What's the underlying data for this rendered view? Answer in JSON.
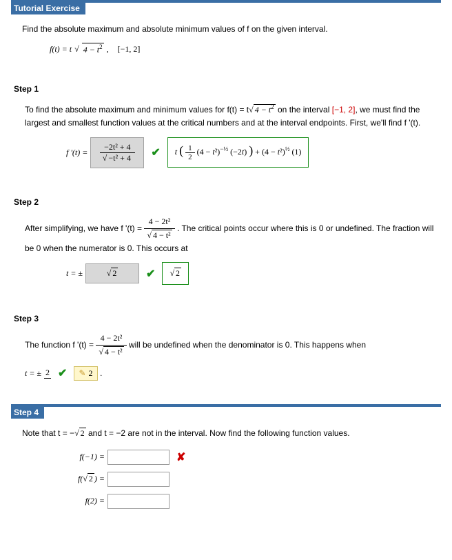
{
  "header": "Tutorial Exercise",
  "intro": {
    "prompt": "Find the absolute maximum and absolute minimum values of f on the given interval.",
    "func_lhs": "f(t) = t",
    "func_radicand": "4 − t",
    "func_exp": "2",
    "interval": "[−1, 2]"
  },
  "step1": {
    "title": "Step 1",
    "text_a": "To find the absolute maximum and minimum values for  f(t) = t",
    "text_a_rad": "4 − t",
    "text_a_exp": "2",
    "text_a2": "  on the interval  ",
    "text_interval": "[−1, 2]",
    "text_b": ",  we must find the largest and smallest function values at the critical numbers and at the interval endpoints. First, we'll find f '(t).",
    "lhs": "f '(t) =",
    "grey_num": "−2t² + 4",
    "grey_den_rad": "−t² + 4",
    "green_expr": "t ( ½ (4 − t²)^{−½} (−2t) ) + (4 − t²)^{½} (1)"
  },
  "step2": {
    "title": "Step 2",
    "text_a": "After simplifying, we have  f '(t) = ",
    "frac_num": "4 − 2t²",
    "frac_den_rad": "4 − t²",
    "text_b": ". The critical points occur where this is 0 or undefined. The fraction will be 0 when the numerator is 0. This occurs at",
    "t_equals": "t = ±",
    "grey_val_rad": "2",
    "green_val_rad": "2"
  },
  "step3": {
    "title": "Step 3",
    "text_a": "The function  f '(t) = ",
    "frac_num": "4 − 2t²",
    "frac_den_rad": "4 − t²",
    "text_b": " will be undefined when the denominator is 0. This happens when",
    "t_equals": "t = ±",
    "user_ans": "2",
    "boxed_ans": "2",
    "period": "."
  },
  "step4": {
    "title": "Step 4",
    "text_a": "Note that  t = −",
    "text_a_rad": "2",
    "text_b": "  and t = −2 are not in the interval. Now find the following function values.",
    "rows": {
      "r1_label": "f(−1) =",
      "r2_label_pre": "f(",
      "r2_label_rad": "2",
      "r2_label_post": ") =",
      "r3_label": "f(2) ="
    }
  }
}
